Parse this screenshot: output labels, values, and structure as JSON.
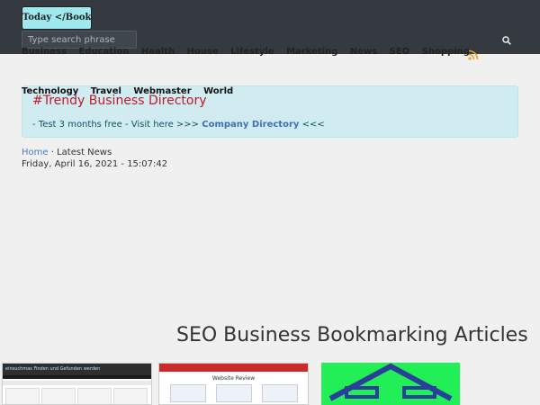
{
  "header": {
    "logo_text": "Today </Bookmarking>",
    "search_placeholder": "Type search phrase"
  },
  "nav": {
    "primary": [
      "Business",
      "Education",
      "Health",
      "House",
      "Lifestyle",
      "Marketing",
      "News",
      "SEO",
      "Shopping"
    ],
    "secondary": [
      "Technology",
      "Travel",
      "Webmaster",
      "World"
    ]
  },
  "banner": {
    "title": "#Trendy Business Directory",
    "text_before": "- Test 3 months free - Visit here >>>",
    "link_text": "Company Directory",
    "text_after": "<<<"
  },
  "breadcrumb": {
    "home": "Home",
    "separator": "·",
    "current": "Latest News"
  },
  "datetime": "Friday, April 16, 2021 - 15:07:42",
  "section": {
    "title": "SEO Business Bookmarking Articles"
  },
  "thumbnails": [
    {
      "caption": "einsuchmas Finden und Gefunden werden"
    },
    {
      "caption": "Website Review"
    },
    {
      "caption": ""
    }
  ],
  "colors": {
    "topbar": "#343a40",
    "banner_bg": "#d1ecf1",
    "banner_title": "#c0192d",
    "link": "#3e6fb8",
    "thumb_green": "#22ee55"
  },
  "icons": {
    "search": "search-icon",
    "rss": "rss-icon",
    "house": "house-icon"
  }
}
